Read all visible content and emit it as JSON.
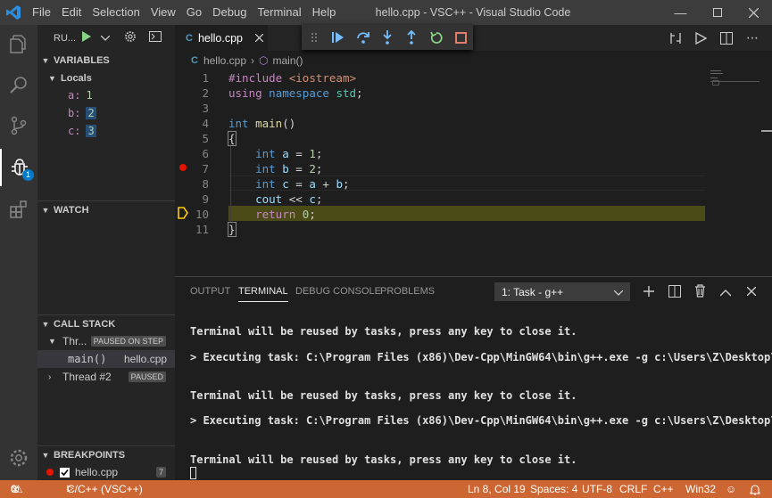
{
  "titlebar": {
    "menu": [
      "File",
      "Edit",
      "Selection",
      "View",
      "Go",
      "Debug",
      "Terminal",
      "Help"
    ],
    "title": "hello.cpp - VSC++ - Visual Studio Code"
  },
  "activity": {
    "debug_badge": "1"
  },
  "sidebar": {
    "launch_config": "RU...",
    "variables": {
      "header": "VARIABLES",
      "locals_label": "Locals",
      "items": [
        {
          "name": "a:",
          "value": "1"
        },
        {
          "name": "b:",
          "value": "2"
        },
        {
          "name": "c:",
          "value": "3"
        }
      ]
    },
    "watch_header": "WATCH",
    "callstack": {
      "header": "CALL STACK",
      "thread1": "Thr...",
      "thread1_status": "PAUSED ON STEP",
      "frame_name": "main()",
      "frame_file": "hello.cpp",
      "thread2": "Thread #2",
      "thread2_status": "PAUSED"
    },
    "breakpoints": {
      "header": "BREAKPOINTS",
      "file": "hello.cpp",
      "line": "7"
    }
  },
  "editor": {
    "tab_label": "hello.cpp",
    "breadcrumb_file": "hello.cpp",
    "breadcrumb_symbol": "main()",
    "lines": [
      {
        "n": "1",
        "t": "#include <iostream>"
      },
      {
        "n": "2",
        "t": "using namespace std;"
      },
      {
        "n": "3",
        "t": ""
      },
      {
        "n": "4",
        "t": "int main()"
      },
      {
        "n": "5",
        "t": "{"
      },
      {
        "n": "6",
        "t": "    int a = 1;"
      },
      {
        "n": "7",
        "t": "    int b = 2;"
      },
      {
        "n": "8",
        "t": "    int c = a + b;"
      },
      {
        "n": "9",
        "t": "    cout << c;"
      },
      {
        "n": "10",
        "t": "    return 0;"
      },
      {
        "n": "11",
        "t": "}"
      }
    ]
  },
  "panel": {
    "tabs": [
      "OUTPUT",
      "TERMINAL",
      "DEBUG CONSOLE",
      "PROBLEMS"
    ],
    "active_tab": "TERMINAL",
    "terminal_select": "1: Task - g++",
    "terminal_lines": [
      "Terminal will be reused by tasks, press any key to close it.",
      "> Executing task: C:\\Program Files (x86)\\Dev-Cpp\\MinGW64\\bin\\g++.exe -g c:\\Users\\Z\\Desktop\\V",
      "Terminal will be reused by tasks, press any key to close it.",
      "> Executing task: C:\\Program Files (x86)\\Dev-Cpp\\MinGW64\\bin\\g++.exe -g c:\\Users\\Z\\Desktop\\V",
      "Terminal will be reused by tasks, press any key to close it."
    ]
  },
  "statusbar": {
    "errors": "0",
    "warnings": "0",
    "debug_config": "C/C++ (VSC++)",
    "position": "Ln 8, Col 19",
    "spaces": "Spaces: 4",
    "encoding": "UTF-8",
    "eol": "CRLF",
    "language": "C++",
    "platform": "Win32"
  },
  "colors": {
    "statusbar": "#cc6633",
    "current_line_highlight": "#4b4b18",
    "breakpoint": "#e51400",
    "activity_badge": "#007acc"
  }
}
